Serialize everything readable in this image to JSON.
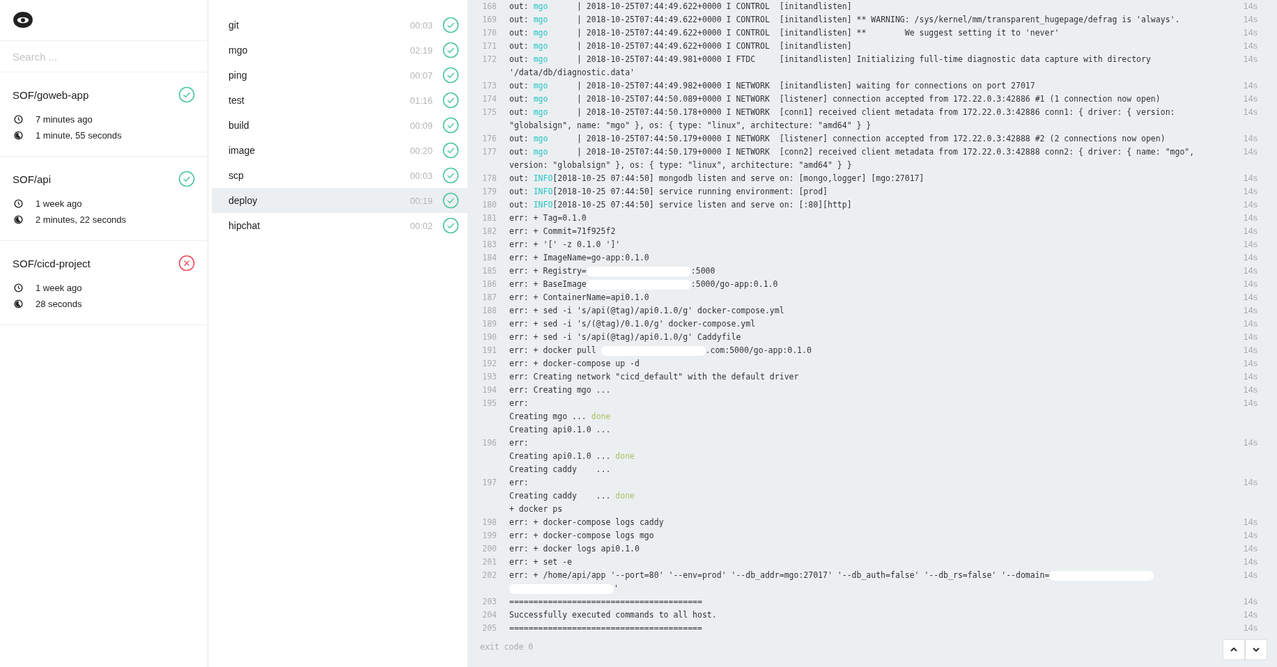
{
  "search": {
    "placeholder": "Search ..."
  },
  "repos": [
    {
      "name": "SOF/goweb-app",
      "success": true,
      "started": "7 minutes ago",
      "duration": "1 minute, 55 seconds"
    },
    {
      "name": "SOF/api",
      "success": true,
      "started": "1 week ago",
      "duration": "2 minutes, 22 seconds"
    },
    {
      "name": "SOF/cicd-project",
      "success": false,
      "started": "1 week ago",
      "duration": "28 seconds"
    }
  ],
  "steps": [
    {
      "name": "git",
      "time": "00:03",
      "success": true,
      "selected": false
    },
    {
      "name": "mgo",
      "time": "02:19",
      "success": true,
      "selected": false
    },
    {
      "name": "ping",
      "time": "00:07",
      "success": true,
      "selected": false
    },
    {
      "name": "test",
      "time": "01:16",
      "success": true,
      "selected": false
    },
    {
      "name": "build",
      "time": "00:09",
      "success": true,
      "selected": false
    },
    {
      "name": "image",
      "time": "00:20",
      "success": true,
      "selected": false
    },
    {
      "name": "scp",
      "time": "00:03",
      "success": true,
      "selected": false
    },
    {
      "name": "deploy",
      "time": "00:19",
      "success": true,
      "selected": true
    },
    {
      "name": "hipchat",
      "time": "00:02",
      "success": true,
      "selected": false
    }
  ],
  "log": {
    "entries": [
      {
        "number": "168",
        "time": "14s",
        "lines": [
          [
            {
              "kind": "plain",
              "text": "out: "
            },
            {
              "kind": "tag",
              "text": "mgo"
            },
            {
              "kind": "plain",
              "text": "      | 2018-10-25T07:44:49.622+0000 I CONTROL  [initandlisten]"
            }
          ]
        ]
      },
      {
        "number": "169",
        "time": "14s",
        "lines": [
          [
            {
              "kind": "plain",
              "text": "out: "
            },
            {
              "kind": "tag",
              "text": "mgo"
            },
            {
              "kind": "plain",
              "text": "      | 2018-10-25T07:44:49.622+0000 I CONTROL  [initandlisten] ** WARNING: /sys/kernel/mm/transparent_hugepage/defrag is 'always'."
            }
          ]
        ]
      },
      {
        "number": "170",
        "time": "14s",
        "lines": [
          [
            {
              "kind": "plain",
              "text": "out: "
            },
            {
              "kind": "tag",
              "text": "mgo"
            },
            {
              "kind": "plain",
              "text": "      | 2018-10-25T07:44:49.622+0000 I CONTROL  [initandlisten] **        We suggest setting it to 'never'"
            }
          ]
        ]
      },
      {
        "number": "171",
        "time": "14s",
        "lines": [
          [
            {
              "kind": "plain",
              "text": "out: "
            },
            {
              "kind": "tag",
              "text": "mgo"
            },
            {
              "kind": "plain",
              "text": "      | 2018-10-25T07:44:49.622+0000 I CONTROL  [initandlisten]"
            }
          ]
        ]
      },
      {
        "number": "172",
        "time": "14s",
        "lines": [
          [
            {
              "kind": "plain",
              "text": "out: "
            },
            {
              "kind": "tag",
              "text": "mgo"
            },
            {
              "kind": "plain",
              "text": "      | 2018-10-25T07:44:49.981+0000 I FTDC     [initandlisten] Initializing full-time diagnostic data capture with directory"
            }
          ],
          [
            {
              "kind": "plain",
              "text": "'/data/db/diagnostic.data'"
            }
          ]
        ]
      },
      {
        "number": "173",
        "time": "14s",
        "lines": [
          [
            {
              "kind": "plain",
              "text": "out: "
            },
            {
              "kind": "tag",
              "text": "mgo"
            },
            {
              "kind": "plain",
              "text": "      | 2018-10-25T07:44:49.982+0000 I NETWORK  [initandlisten] waiting for connections on port 27017"
            }
          ]
        ]
      },
      {
        "number": "174",
        "time": "14s",
        "lines": [
          [
            {
              "kind": "plain",
              "text": "out: "
            },
            {
              "kind": "tag",
              "text": "mgo"
            },
            {
              "kind": "plain",
              "text": "      | 2018-10-25T07:44:50.089+0000 I NETWORK  [listener] connection accepted from 172.22.0.3:42886 #1 (1 connection now open)"
            }
          ]
        ]
      },
      {
        "number": "175",
        "time": "14s",
        "lines": [
          [
            {
              "kind": "plain",
              "text": "out: "
            },
            {
              "kind": "tag",
              "text": "mgo"
            },
            {
              "kind": "plain",
              "text": "      | 2018-10-25T07:44:50.178+0000 I NETWORK  [conn1] received client metadata from 172.22.0.3:42886 conn1: { driver: { version:"
            }
          ],
          [
            {
              "kind": "plain",
              "text": "\"globalsign\", name: \"mgo\" }, os: { type: \"linux\", architecture: \"amd64\" } }"
            }
          ]
        ]
      },
      {
        "number": "176",
        "time": "14s",
        "lines": [
          [
            {
              "kind": "plain",
              "text": "out: "
            },
            {
              "kind": "tag",
              "text": "mgo"
            },
            {
              "kind": "plain",
              "text": "      | 2018-10-25T07:44:50.179+0000 I NETWORK  [listener] connection accepted from 172.22.0.3:42888 #2 (2 connections now open)"
            }
          ]
        ]
      },
      {
        "number": "177",
        "time": "14s",
        "lines": [
          [
            {
              "kind": "plain",
              "text": "out: "
            },
            {
              "kind": "tag",
              "text": "mgo"
            },
            {
              "kind": "plain",
              "text": "      | 2018-10-25T07:44:50.179+0000 I NETWORK  [conn2] received client metadata from 172.22.0.3:42888 conn2: { driver: { name: \"mgo\","
            }
          ],
          [
            {
              "kind": "plain",
              "text": "version: \"globalsign\" }, os: { type: \"linux\", architecture: \"amd64\" } }"
            }
          ]
        ]
      },
      {
        "number": "178",
        "time": "14s",
        "lines": [
          [
            {
              "kind": "plain",
              "text": "out: "
            },
            {
              "kind": "tag",
              "text": "INFO"
            },
            {
              "kind": "plain",
              "text": "[2018-10-25 07:44:50] mongodb listen and serve on: [mongo,logger] [mgo:27017]"
            }
          ]
        ]
      },
      {
        "number": "179",
        "time": "14s",
        "lines": [
          [
            {
              "kind": "plain",
              "text": "out: "
            },
            {
              "kind": "tag",
              "text": "INFO"
            },
            {
              "kind": "plain",
              "text": "[2018-10-25 07:44:50] service running environment: [prod]"
            }
          ]
        ]
      },
      {
        "number": "180",
        "time": "14s",
        "lines": [
          [
            {
              "kind": "plain",
              "text": "out: "
            },
            {
              "kind": "tag",
              "text": "INFO"
            },
            {
              "kind": "plain",
              "text": "[2018-10-25 07:44:50] service listen and serve on: [:80][http]"
            }
          ]
        ]
      },
      {
        "number": "181",
        "time": "14s",
        "lines": [
          [
            {
              "kind": "plain",
              "text": "err: + Tag=0.1.0"
            }
          ]
        ]
      },
      {
        "number": "182",
        "time": "14s",
        "lines": [
          [
            {
              "kind": "plain",
              "text": "err: + Commit=71f925f2"
            }
          ]
        ]
      },
      {
        "number": "183",
        "time": "14s",
        "lines": [
          [
            {
              "kind": "plain",
              "text": "err: + '[' -z 0.1.0 ']'"
            }
          ]
        ]
      },
      {
        "number": "184",
        "time": "14s",
        "lines": [
          [
            {
              "kind": "plain",
              "text": "err: + ImageName=go-app:0.1.0"
            }
          ]
        ]
      },
      {
        "number": "185",
        "time": "14s",
        "lines": [
          [
            {
              "kind": "plain",
              "text": "err: + Registry="
            },
            {
              "kind": "redacted"
            },
            {
              "kind": "plain",
              "text": ":5000"
            }
          ]
        ]
      },
      {
        "number": "186",
        "time": "14s",
        "lines": [
          [
            {
              "kind": "plain",
              "text": "err: + BaseImage"
            },
            {
              "kind": "redacted"
            },
            {
              "kind": "plain",
              "text": ":5000/go-app:0.1.0"
            }
          ]
        ]
      },
      {
        "number": "187",
        "time": "14s",
        "lines": [
          [
            {
              "kind": "plain",
              "text": "err: + ContainerName=api0.1.0"
            }
          ]
        ]
      },
      {
        "number": "188",
        "time": "14s",
        "lines": [
          [
            {
              "kind": "plain",
              "text": "err: + sed -i 's/api(@tag)/api0.1.0/g' docker-compose.yml"
            }
          ]
        ]
      },
      {
        "number": "189",
        "time": "14s",
        "lines": [
          [
            {
              "kind": "plain",
              "text": "err: + sed -i 's/(@tag)/0.1.0/g' docker-compose.yml"
            }
          ]
        ]
      },
      {
        "number": "190",
        "time": "14s",
        "lines": [
          [
            {
              "kind": "plain",
              "text": "err: + sed -i 's/api(@tag)/api0.1.0/g' Caddyfile"
            }
          ]
        ]
      },
      {
        "number": "191",
        "time": "14s",
        "lines": [
          [
            {
              "kind": "plain",
              "text": "err: + docker pull "
            },
            {
              "kind": "redacted"
            },
            {
              "kind": "plain",
              "text": ".com:5000/go-app:0.1.0"
            }
          ]
        ]
      },
      {
        "number": "192",
        "time": "14s",
        "lines": [
          [
            {
              "kind": "plain",
              "text": "err: + docker-compose up -d"
            }
          ]
        ]
      },
      {
        "number": "193",
        "time": "14s",
        "lines": [
          [
            {
              "kind": "plain",
              "text": "err: Creating network \"cicd_default\" with the default driver"
            }
          ]
        ]
      },
      {
        "number": "194",
        "time": "14s",
        "lines": [
          [
            {
              "kind": "plain",
              "text": "err: Creating mgo ..."
            }
          ]
        ]
      },
      {
        "number": "195",
        "time": "14s",
        "lines": [
          [
            {
              "kind": "plain",
              "text": "err:"
            }
          ],
          [
            {
              "kind": "plain",
              "text": "Creating mgo ... "
            },
            {
              "kind": "done",
              "text": "done"
            }
          ],
          [
            {
              "kind": "plain",
              "text": "Creating api0.1.0 ..."
            }
          ]
        ]
      },
      {
        "number": "196",
        "time": "14s",
        "lines": [
          [
            {
              "kind": "plain",
              "text": "err:"
            }
          ],
          [
            {
              "kind": "plain",
              "text": "Creating api0.1.0 ... "
            },
            {
              "kind": "done",
              "text": "done"
            }
          ],
          [
            {
              "kind": "plain",
              "text": "Creating caddy    ..."
            }
          ]
        ]
      },
      {
        "number": "197",
        "time": "14s",
        "lines": [
          [
            {
              "kind": "plain",
              "text": "err:"
            }
          ],
          [
            {
              "kind": "plain",
              "text": "Creating caddy    ... "
            },
            {
              "kind": "done",
              "text": "done"
            }
          ],
          [
            {
              "kind": "plain",
              "text": "+ docker ps"
            }
          ]
        ]
      },
      {
        "number": "198",
        "time": "14s",
        "lines": [
          [
            {
              "kind": "plain",
              "text": "err: + docker-compose logs caddy"
            }
          ]
        ]
      },
      {
        "number": "199",
        "time": "14s",
        "lines": [
          [
            {
              "kind": "plain",
              "text": "err: + docker-compose logs mgo"
            }
          ]
        ]
      },
      {
        "number": "200",
        "time": "14s",
        "lines": [
          [
            {
              "kind": "plain",
              "text": "err: + docker logs api0.1.0"
            }
          ]
        ]
      },
      {
        "number": "201",
        "time": "14s",
        "lines": [
          [
            {
              "kind": "plain",
              "text": "err: + set -e"
            }
          ]
        ]
      },
      {
        "number": "202",
        "time": "14s",
        "lines": [
          [
            {
              "kind": "plain",
              "text": "err: + /home/api/app '--port=80' '--env=prod' '--db_addr=mgo:27017' '--db_auth=false' '--db_rs=false' '--domain="
            },
            {
              "kind": "redacted"
            }
          ],
          [
            {
              "kind": "redacted"
            },
            {
              "kind": "plain",
              "text": "'"
            }
          ]
        ]
      },
      {
        "number": "203",
        "time": "14s",
        "lines": [
          [
            {
              "kind": "plain",
              "text": "========================================"
            }
          ]
        ]
      },
      {
        "number": "204",
        "time": "14s",
        "lines": [
          [
            {
              "kind": "plain",
              "text": "Successfully executed commands to all host."
            }
          ]
        ]
      },
      {
        "number": "205",
        "time": "14s",
        "lines": [
          [
            {
              "kind": "plain",
              "text": "========================================"
            }
          ]
        ]
      }
    ],
    "exit": "exit code 0"
  }
}
